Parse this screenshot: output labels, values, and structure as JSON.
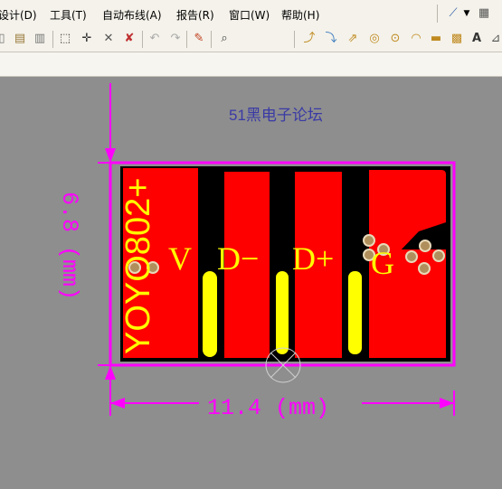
{
  "menu": {
    "items": [
      "设计(D)",
      "工具(T)",
      "自动布线(A)",
      "报告(R)",
      "窗口(W)",
      "帮助(H)"
    ]
  },
  "toolbar_icons": [
    "copy-icon",
    "paste-icon",
    "rubber-stamp-icon",
    "select-rect-icon",
    "move-icon",
    "cross-select-icon",
    "clear-icon",
    "undo-icon",
    "redo-icon",
    "pencil-icon",
    "zoom-icon",
    "route-icon",
    "multi-route-icon",
    "diff-route-icon",
    "via-icon",
    "pad-icon",
    "arc-icon",
    "fill-icon",
    "polygon-icon",
    "text-icon",
    "angle-icon"
  ],
  "board": {
    "watermark": "51黑电子论坛",
    "labels": {
      "v": "V",
      "dminus": "D−",
      "dplus": "D+",
      "g": "G",
      "part_name": "YOYO802+"
    },
    "dimensions": {
      "height": "6.8 (mm)",
      "width": "11.4 (mm)"
    },
    "colors": {
      "background": "#8e8e8e",
      "copper": "#ff0000",
      "silkscreen": "#ffff00",
      "dimension": "#ff00ff",
      "board_fill": "#000000",
      "watermark": "#3a3aa6",
      "via": "#b08f5c"
    }
  }
}
